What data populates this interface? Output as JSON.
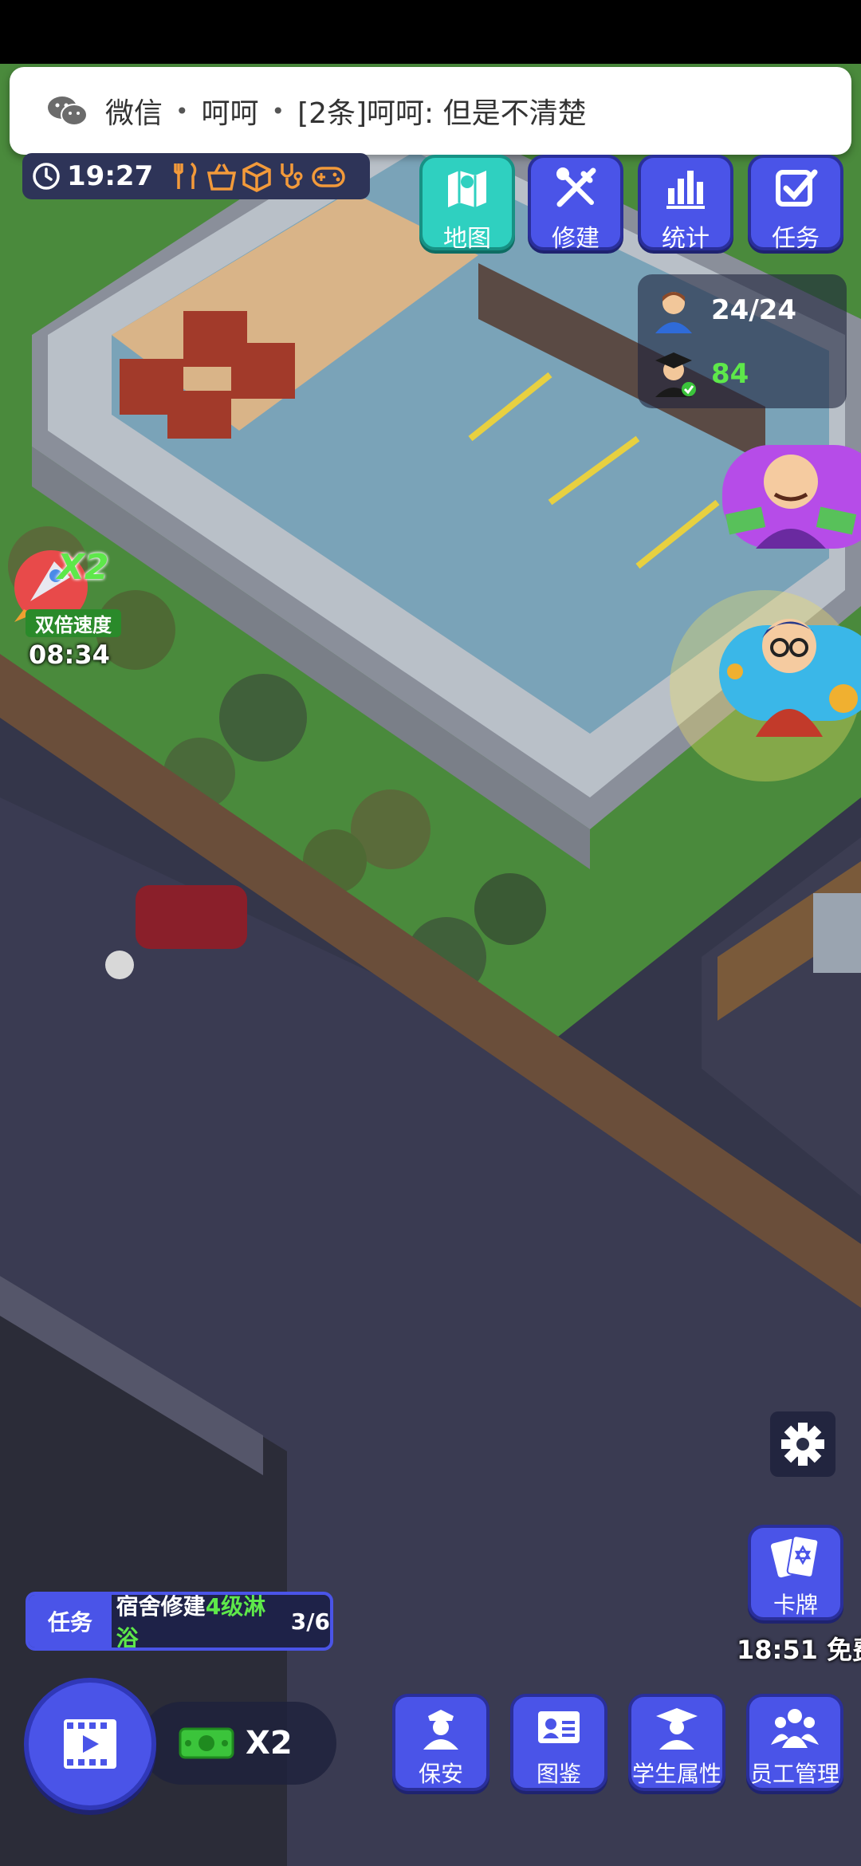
{
  "notification": {
    "app": "微信",
    "sender": "呵呵",
    "message": "[2条]呵呵: 但是不清楚"
  },
  "clock": {
    "time": "19:27"
  },
  "top_buttons": [
    {
      "label": "地图",
      "icon": "map-icon"
    },
    {
      "label": "修建",
      "icon": "build-tools-icon"
    },
    {
      "label": "统计",
      "icon": "bar-chart-icon"
    },
    {
      "label": "任务",
      "icon": "checkbox-icon"
    }
  ],
  "stats": {
    "students": "24/24",
    "graduates": "84"
  },
  "speed_boost": {
    "multiplier": "X2",
    "label": "双倍速度",
    "timer": "08:34"
  },
  "task": {
    "tag": "任务",
    "text_prefix": "宿舍修建",
    "highlight": "4级淋浴",
    "progress": "3/6"
  },
  "cash_multiplier": "X2",
  "bottom_buttons": [
    {
      "label": "保安",
      "icon": "security-guard-icon"
    },
    {
      "label": "图鉴",
      "icon": "id-card-icon"
    },
    {
      "label": "学生属性",
      "icon": "graduate-icon"
    },
    {
      "label": "员工管理",
      "icon": "staff-group-icon"
    }
  ],
  "cards": {
    "label": "卡牌",
    "timer": "18:51 免费"
  },
  "colors": {
    "button_blue": "#4a54e8",
    "map_teal": "#2fd0c0",
    "highlight_green": "#5ee84a"
  }
}
